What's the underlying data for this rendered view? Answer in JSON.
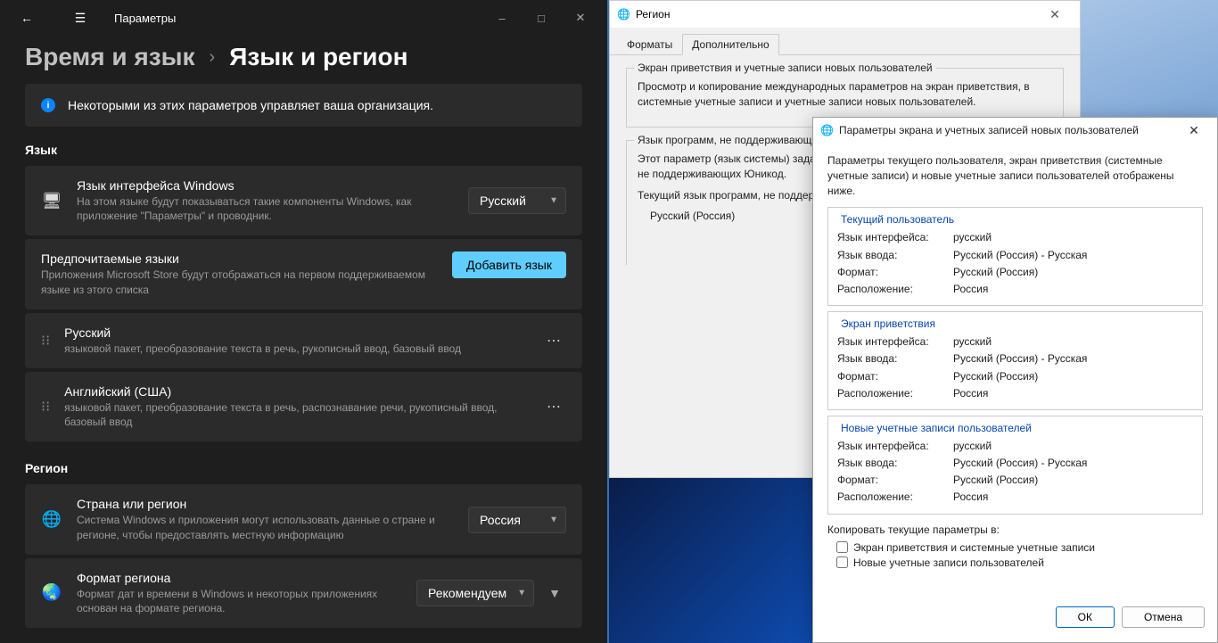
{
  "settings": {
    "window_title": "Параметры",
    "breadcrumb_parent": "Время и язык",
    "breadcrumb_current": "Язык и регион",
    "banner": "Некоторыми из этих параметров управляет ваша организация.",
    "section_language": "Язык",
    "section_region": "Регион",
    "windows_lang": {
      "title": "Язык интерфейса Windows",
      "sub": "На этом языке будут показываться такие компоненты Windows, как приложение \"Параметры\" и проводник.",
      "value": "Русский"
    },
    "preferred": {
      "title": "Предпочитаемые языки",
      "sub": "Приложения Microsoft Store будут отображаться на первом поддерживаемом языке из этого списка",
      "add_btn": "Добавить язык"
    },
    "langs": [
      {
        "name": "Русский",
        "sub": "языковой пакет, преобразование текста в речь, рукописный ввод, базовый ввод"
      },
      {
        "name": "Английский (США)",
        "sub": "языковой пакет, преобразование текста в речь, распознавание речи, рукописный ввод, базовый ввод"
      }
    ],
    "country": {
      "title": "Страна или регион",
      "sub": "Система Windows и приложения могут использовать данные о стране и регионе, чтобы предоставлять местную информацию",
      "value": "Россия"
    },
    "region_format": {
      "title": "Формат региона",
      "sub": "Формат дат и времени в Windows и некоторых приложениях основан на формате региона.",
      "value": "Рекомендуем"
    }
  },
  "region": {
    "title": "Регион",
    "tab_formats": "Форматы",
    "tab_additional": "Дополнительно",
    "welcome_section": "Экран приветствия и учетные записи новых пользователей",
    "welcome_text": "Просмотр и копирование международных параметров на экран приветствия, в системные учетные записи и учетные записи новых пользователей.",
    "nonunicode_section": "Язык программ, не поддерживающих Юникод",
    "nonunicode_text": "Этот параметр (язык системы) задает язык для отображения текста в программах, не поддерживающих Юникод.",
    "current_lang_label": "Текущий язык программ, не поддерживающих Юникод:",
    "current_lang_value": "Русский (Россия)"
  },
  "dlg": {
    "title": "Параметры экрана и учетных записей новых пользователей",
    "intro": "Параметры текущего пользователя, экран приветствия (системные учетные записи) и новые учетные записи пользователей отображены ниже.",
    "groups": {
      "current": "Текущий пользователь",
      "welcome": "Экран приветствия",
      "newusers": "Новые учетные записи пользователей"
    },
    "labels": {
      "ui_lang": "Язык интерфейса:",
      "input_lang": "Язык ввода:",
      "format": "Формат:",
      "location": "Расположение:"
    },
    "values": {
      "ui_lang": "русский",
      "input_lang": "Русский (Россия) - Русская",
      "format": "Русский (Россия)",
      "location": "Россия"
    },
    "copy_label": "Копировать текущие параметры в:",
    "chk_welcome": "Экран приветствия и системные учетные записи",
    "chk_newusers": "Новые учетные записи пользователей",
    "ok": "ОК",
    "cancel": "Отмена"
  }
}
